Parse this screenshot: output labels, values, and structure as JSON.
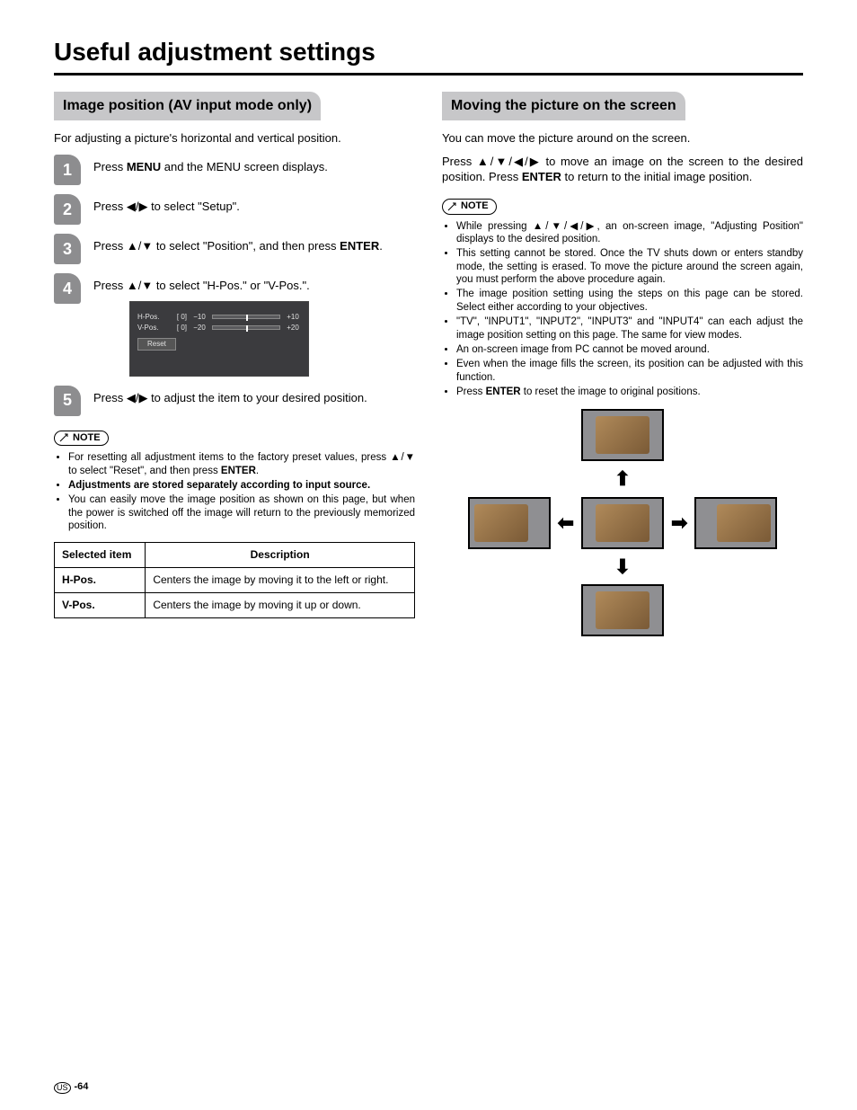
{
  "page_title": "Useful adjustment settings",
  "left": {
    "heading": "Image position (AV input mode only)",
    "intro": "For adjusting a picture's horizontal and vertical position.",
    "steps": {
      "s1_pre": "Press ",
      "s1_bold": "MENU",
      "s1_post": " and the MENU screen displays.",
      "s2_pre": "Press ",
      "s2_arrows": "◀/▶",
      "s2_post": " to select \"Setup\".",
      "s3_pre": "Press ",
      "s3_arrows": "▲/▼",
      "s3_mid": " to select \"Position\", and then press ",
      "s3_bold": "ENTER",
      "s3_post": ".",
      "s4_pre": "Press ",
      "s4_arrows": "▲/▼",
      "s4_post": " to select \"H-Pos.\" or \"V-Pos.\".",
      "s5_pre": "Press ",
      "s5_arrows": "◀/▶",
      "s5_post": " to adjust the item to your desired position."
    },
    "osd": {
      "h_label": "H-Pos.",
      "h_val": "[  0]",
      "h_min": "−10",
      "h_max": "+10",
      "v_label": "V-Pos.",
      "v_val": "[  0]",
      "v_min": "−20",
      "v_max": "+20",
      "reset": "Reset"
    },
    "note_label": "NOTE",
    "notes": {
      "n1_pre": "For resetting all adjustment items to the factory preset values, press ",
      "n1_arrows": "▲/▼",
      "n1_mid": " to select \"Reset\", and then press ",
      "n1_bold": "ENTER",
      "n1_post": ".",
      "n2_bold": "Adjustments are stored separately according to input source.",
      "n3": "You can easily move the image position as shown on this page, but when the power is switched off the image will return to the previously memorized position."
    },
    "table": {
      "th1": "Selected item",
      "th2": "Description",
      "r1c1": "H-Pos.",
      "r1c2": "Centers the image by moving it to the left or right.",
      "r2c1": "V-Pos.",
      "r2c2": "Centers the image by moving it up or down."
    }
  },
  "right": {
    "heading": "Moving the picture on the screen",
    "intro": "You can move the picture around on the screen.",
    "p2_pre": "Press ",
    "p2_arrows": "▲/▼/◀/▶",
    "p2_mid": " to move an image on the screen to the desired position. Press ",
    "p2_bold": "ENTER",
    "p2_post": " to return to the initial image position.",
    "note_label": "NOTE",
    "notes": {
      "n1_pre": "While pressing ",
      "n1_arrows": "▲/▼/◀/▶",
      "n1_post": ", an on-screen image, \"Adjusting Position\" displays to the desired position.",
      "n2": "This setting cannot be stored. Once the TV shuts down or enters standby mode, the setting is erased. To move the picture around the screen again, you must perform the above procedure again.",
      "n3": "The image position setting using the steps on this page can be stored. Select either according to your objectives.",
      "n4": "\"TV\", \"INPUT1\", \"INPUT2\", \"INPUT3\" and \"INPUT4\" can each adjust the image position setting on this page. The same for view modes.",
      "n5": "An on-screen image from PC cannot be moved around.",
      "n6": "Even when the image fills the screen, its position can be adjusted with this function.",
      "n7_pre": "Press ",
      "n7_bold": "ENTER",
      "n7_post": " to reset the image to original positions."
    }
  },
  "footer": {
    "region": "US",
    "page": "-64"
  }
}
